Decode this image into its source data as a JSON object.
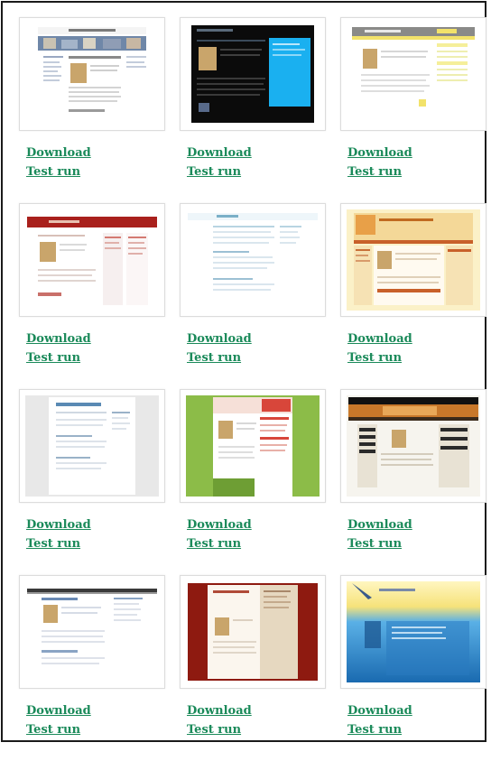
{
  "themes": [
    {
      "id": "t1",
      "download_label": "Download",
      "test_label": "Test run"
    },
    {
      "id": "t2",
      "download_label": "Download",
      "test_label": "Test run"
    },
    {
      "id": "t3",
      "download_label": "Download",
      "test_label": "Test run"
    },
    {
      "id": "t4",
      "download_label": "Download",
      "test_label": "Test run"
    },
    {
      "id": "t5",
      "download_label": "Download",
      "test_label": "Test run"
    },
    {
      "id": "t6",
      "download_label": "Download",
      "test_label": "Test run"
    },
    {
      "id": "t7",
      "download_label": "Download",
      "test_label": "Test run"
    },
    {
      "id": "t8",
      "download_label": "Download",
      "test_label": "Test run"
    },
    {
      "id": "t9",
      "download_label": "Download",
      "test_label": "Test run"
    },
    {
      "id": "t10",
      "download_label": "Download",
      "test_label": "Test run"
    },
    {
      "id": "t11",
      "download_label": "Download",
      "test_label": "Test run"
    },
    {
      "id": "t12",
      "download_label": "Download",
      "test_label": "Test run"
    }
  ],
  "colors": {
    "link": "#1b8a5a",
    "border": "#1a1a1a"
  }
}
